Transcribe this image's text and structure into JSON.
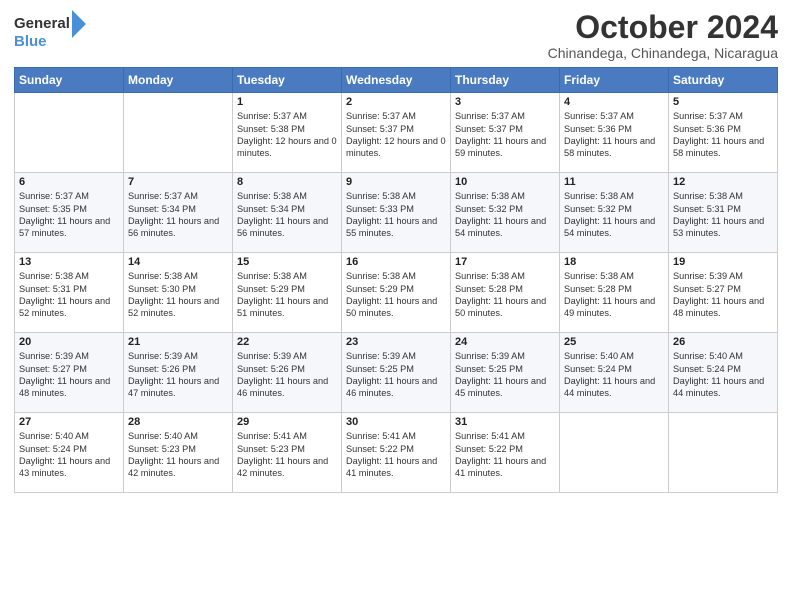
{
  "logo": {
    "line1": "General",
    "line2": "Blue"
  },
  "title": "October 2024",
  "subtitle": "Chinandega, Chinandega, Nicaragua",
  "weekdays": [
    "Sunday",
    "Monday",
    "Tuesday",
    "Wednesday",
    "Thursday",
    "Friday",
    "Saturday"
  ],
  "weeks": [
    [
      {
        "day": null,
        "info": null
      },
      {
        "day": null,
        "info": null
      },
      {
        "day": "1",
        "sunrise": "5:37 AM",
        "sunset": "5:38 PM",
        "daylight": "12 hours and 0 minutes."
      },
      {
        "day": "2",
        "sunrise": "5:37 AM",
        "sunset": "5:37 PM",
        "daylight": "12 hours and 0 minutes."
      },
      {
        "day": "3",
        "sunrise": "5:37 AM",
        "sunset": "5:37 PM",
        "daylight": "11 hours and 59 minutes."
      },
      {
        "day": "4",
        "sunrise": "5:37 AM",
        "sunset": "5:36 PM",
        "daylight": "11 hours and 58 minutes."
      },
      {
        "day": "5",
        "sunrise": "5:37 AM",
        "sunset": "5:36 PM",
        "daylight": "11 hours and 58 minutes."
      }
    ],
    [
      {
        "day": "6",
        "sunrise": "5:37 AM",
        "sunset": "5:35 PM",
        "daylight": "11 hours and 57 minutes."
      },
      {
        "day": "7",
        "sunrise": "5:37 AM",
        "sunset": "5:34 PM",
        "daylight": "11 hours and 56 minutes."
      },
      {
        "day": "8",
        "sunrise": "5:38 AM",
        "sunset": "5:34 PM",
        "daylight": "11 hours and 56 minutes."
      },
      {
        "day": "9",
        "sunrise": "5:38 AM",
        "sunset": "5:33 PM",
        "daylight": "11 hours and 55 minutes."
      },
      {
        "day": "10",
        "sunrise": "5:38 AM",
        "sunset": "5:32 PM",
        "daylight": "11 hours and 54 minutes."
      },
      {
        "day": "11",
        "sunrise": "5:38 AM",
        "sunset": "5:32 PM",
        "daylight": "11 hours and 54 minutes."
      },
      {
        "day": "12",
        "sunrise": "5:38 AM",
        "sunset": "5:31 PM",
        "daylight": "11 hours and 53 minutes."
      }
    ],
    [
      {
        "day": "13",
        "sunrise": "5:38 AM",
        "sunset": "5:31 PM",
        "daylight": "11 hours and 52 minutes."
      },
      {
        "day": "14",
        "sunrise": "5:38 AM",
        "sunset": "5:30 PM",
        "daylight": "11 hours and 52 minutes."
      },
      {
        "day": "15",
        "sunrise": "5:38 AM",
        "sunset": "5:29 PM",
        "daylight": "11 hours and 51 minutes."
      },
      {
        "day": "16",
        "sunrise": "5:38 AM",
        "sunset": "5:29 PM",
        "daylight": "11 hours and 50 minutes."
      },
      {
        "day": "17",
        "sunrise": "5:38 AM",
        "sunset": "5:28 PM",
        "daylight": "11 hours and 50 minutes."
      },
      {
        "day": "18",
        "sunrise": "5:38 AM",
        "sunset": "5:28 PM",
        "daylight": "11 hours and 49 minutes."
      },
      {
        "day": "19",
        "sunrise": "5:39 AM",
        "sunset": "5:27 PM",
        "daylight": "11 hours and 48 minutes."
      }
    ],
    [
      {
        "day": "20",
        "sunrise": "5:39 AM",
        "sunset": "5:27 PM",
        "daylight": "11 hours and 48 minutes."
      },
      {
        "day": "21",
        "sunrise": "5:39 AM",
        "sunset": "5:26 PM",
        "daylight": "11 hours and 47 minutes."
      },
      {
        "day": "22",
        "sunrise": "5:39 AM",
        "sunset": "5:26 PM",
        "daylight": "11 hours and 46 minutes."
      },
      {
        "day": "23",
        "sunrise": "5:39 AM",
        "sunset": "5:25 PM",
        "daylight": "11 hours and 46 minutes."
      },
      {
        "day": "24",
        "sunrise": "5:39 AM",
        "sunset": "5:25 PM",
        "daylight": "11 hours and 45 minutes."
      },
      {
        "day": "25",
        "sunrise": "5:40 AM",
        "sunset": "5:24 PM",
        "daylight": "11 hours and 44 minutes."
      },
      {
        "day": "26",
        "sunrise": "5:40 AM",
        "sunset": "5:24 PM",
        "daylight": "11 hours and 44 minutes."
      }
    ],
    [
      {
        "day": "27",
        "sunrise": "5:40 AM",
        "sunset": "5:24 PM",
        "daylight": "11 hours and 43 minutes."
      },
      {
        "day": "28",
        "sunrise": "5:40 AM",
        "sunset": "5:23 PM",
        "daylight": "11 hours and 42 minutes."
      },
      {
        "day": "29",
        "sunrise": "5:41 AM",
        "sunset": "5:23 PM",
        "daylight": "11 hours and 42 minutes."
      },
      {
        "day": "30",
        "sunrise": "5:41 AM",
        "sunset": "5:22 PM",
        "daylight": "11 hours and 41 minutes."
      },
      {
        "day": "31",
        "sunrise": "5:41 AM",
        "sunset": "5:22 PM",
        "daylight": "11 hours and 41 minutes."
      },
      {
        "day": null,
        "info": null
      },
      {
        "day": null,
        "info": null
      }
    ]
  ]
}
